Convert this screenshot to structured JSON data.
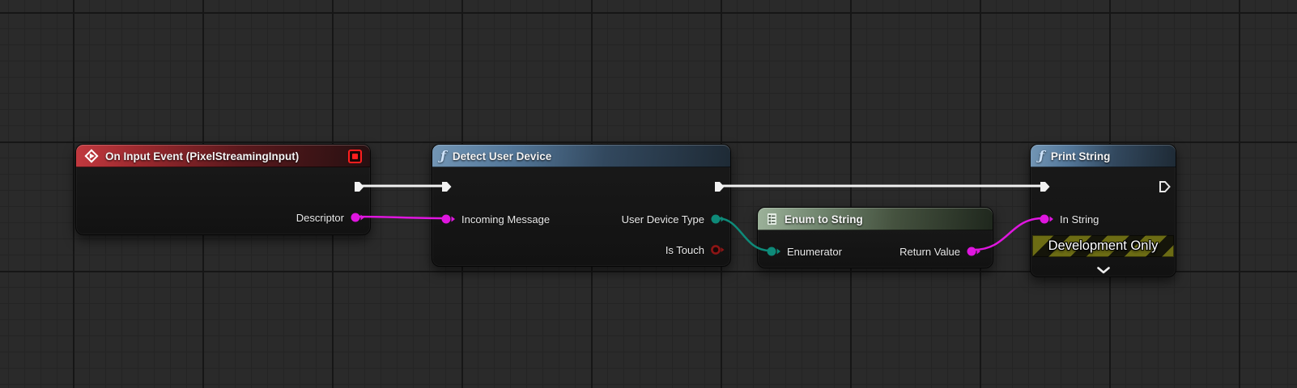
{
  "editor": "Unreal Engine Blueprint Event Graph",
  "colors": {
    "exec": "#f2f2f2",
    "string_pink": "#df16df",
    "enum_teal": "#0e8a79",
    "bool_red": "#8e1515"
  },
  "nodes": {
    "on_input_event": {
      "title": "On Input Event (PixelStreamingInput)",
      "output_pins": {
        "descriptor": "Descriptor"
      }
    },
    "detect_user_device": {
      "title": "Detect User Device",
      "input_pins": {
        "incoming_message": "Incoming Message"
      },
      "output_pins": {
        "user_device_type": "User Device Type",
        "is_touch": "Is Touch"
      }
    },
    "enum_to_string": {
      "title": "Enum to String",
      "input_pins": {
        "enumerator": "Enumerator"
      },
      "output_pins": {
        "return_value": "Return Value"
      }
    },
    "print_string": {
      "title": "Print String",
      "input_pins": {
        "in_string": "In String"
      },
      "banner": "Development Only"
    }
  }
}
